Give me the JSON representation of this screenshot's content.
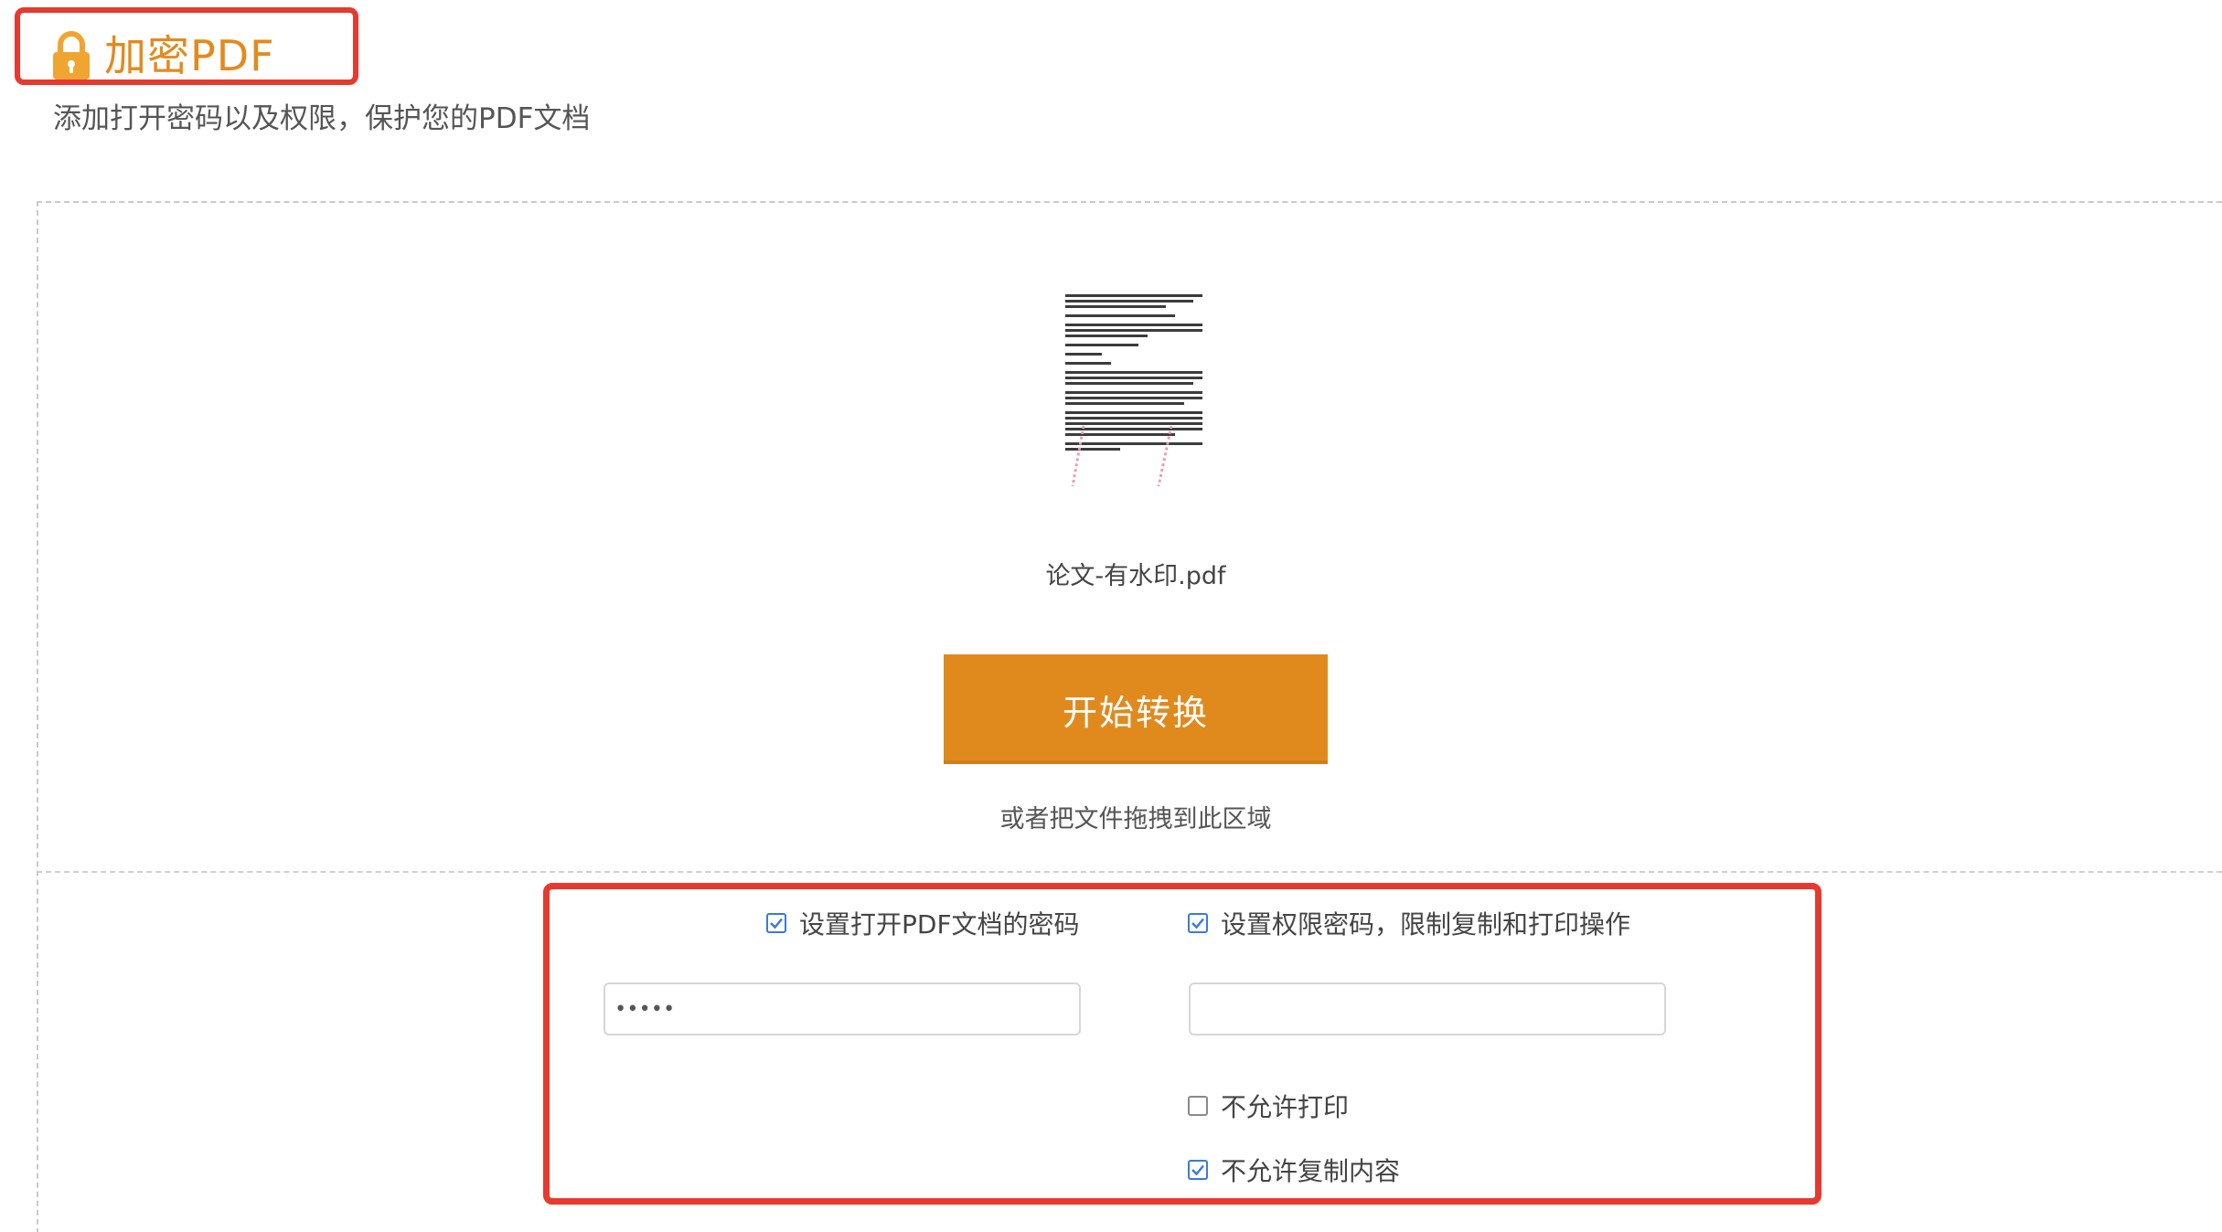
{
  "header": {
    "title": "加密PDF",
    "subtitle": "添加打开密码以及权限，保护您的PDF文档",
    "lock_icon": "lock-icon",
    "accent_color": "#e38a1e"
  },
  "upload": {
    "file_thumbnail_icon": "pdf-page-thumbnail",
    "file_name": "论文-有水印.pdf",
    "start_button_label": "开始转换",
    "start_button_color": "#e08a1e",
    "drop_hint": "或者把文件拖拽到此区域"
  },
  "options": {
    "open_password": {
      "label": "设置打开PDF文档的密码",
      "checked": true,
      "value": "•••••"
    },
    "permission_password": {
      "label": "设置权限密码，限制复制和打印操作",
      "checked": true,
      "value": ""
    },
    "no_print": {
      "label": "不允许打印",
      "checked": false
    },
    "no_copy": {
      "label": "不允许复制内容",
      "checked": true
    }
  },
  "highlight_color": "#e8392f"
}
